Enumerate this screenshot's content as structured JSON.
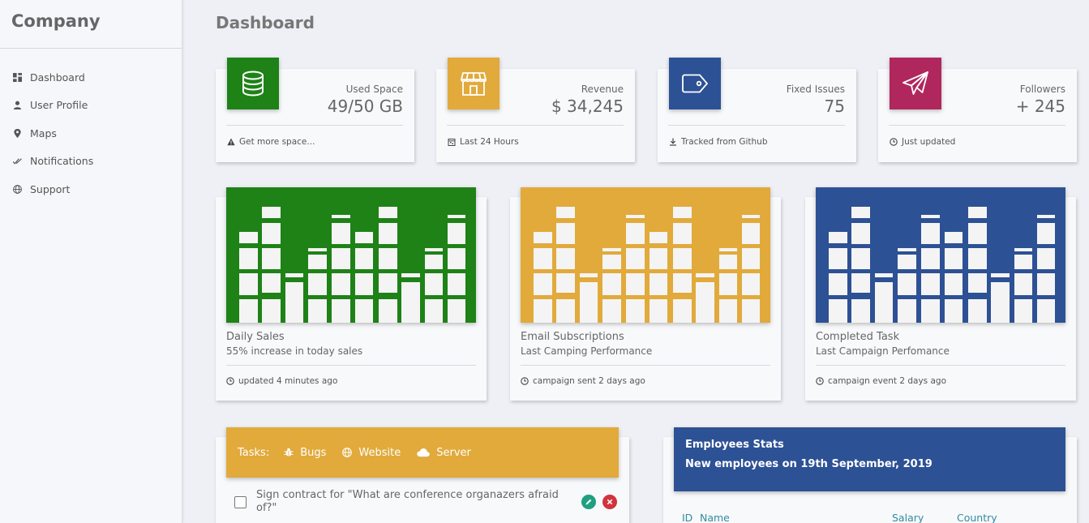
{
  "sidebar": {
    "brand": "Company",
    "items": [
      {
        "label": "Dashboard",
        "icon": "dashboard-icon"
      },
      {
        "label": "User Profile",
        "icon": "user-icon"
      },
      {
        "label": "Maps",
        "icon": "map-pin-icon"
      },
      {
        "label": "Notifications",
        "icon": "double-check-icon"
      },
      {
        "label": "Support",
        "icon": "globe-icon"
      }
    ]
  },
  "main": {
    "title": "Dashboard",
    "stats": [
      {
        "label": "Used Space",
        "value": "49/50 GB",
        "footer": "Get more space...",
        "color": "#1e8217",
        "icon": "database-icon",
        "footer_icon": "warning-icon"
      },
      {
        "label": "Revenue",
        "value": "$ 34,245",
        "footer": "Last 24 Hours",
        "color": "#e1aa3b",
        "icon": "store-icon",
        "footer_icon": "calendar-icon"
      },
      {
        "label": "Fixed Issues",
        "value": "75",
        "footer": "Tracked from Github",
        "color": "#2d5195",
        "icon": "tag-icon",
        "footer_icon": "download-icon"
      },
      {
        "label": "Followers",
        "value": "+ 245",
        "footer": "Just updated",
        "color": "#b0275e",
        "icon": "paper-plane-icon",
        "footer_icon": "clock-icon"
      }
    ],
    "charts": [
      {
        "title": "Daily Sales",
        "subtitle": "55% increase in today sales",
        "footer": "updated 4 minutes ago",
        "color": "#1e8217",
        "footer_icon": "clock-icon"
      },
      {
        "title": "Email Subscriptions",
        "subtitle": "Last Camping Performance",
        "footer": "campaign sent 2 days ago",
        "color": "#e1aa3b",
        "footer_icon": "clock-icon"
      },
      {
        "title": "Completed Task",
        "subtitle": "Last Campaign Perfomance",
        "footer": "campaign event 2 days ago",
        "color": "#2d5195",
        "footer_icon": "clock-icon"
      }
    ],
    "tasks": {
      "label": "Tasks:",
      "tabs": [
        {
          "label": "Bugs",
          "icon": "bug-icon"
        },
        {
          "label": "Website",
          "icon": "globe-icon"
        },
        {
          "label": "Server",
          "icon": "cloud-icon"
        }
      ],
      "items": [
        {
          "text": "Sign contract for \"What are conference organazers afraid of?\"",
          "checked": false
        }
      ],
      "colors": {
        "header": "#e1aa3b",
        "edit": "#1fa080",
        "delete": "#d0343c"
      }
    },
    "employees": {
      "title": "Employees Stats",
      "subtitle": "New employees on 19th September, 2019",
      "columns": [
        "ID",
        "Name",
        "Salary",
        "Country"
      ],
      "header_color": "#2d5195"
    }
  }
}
